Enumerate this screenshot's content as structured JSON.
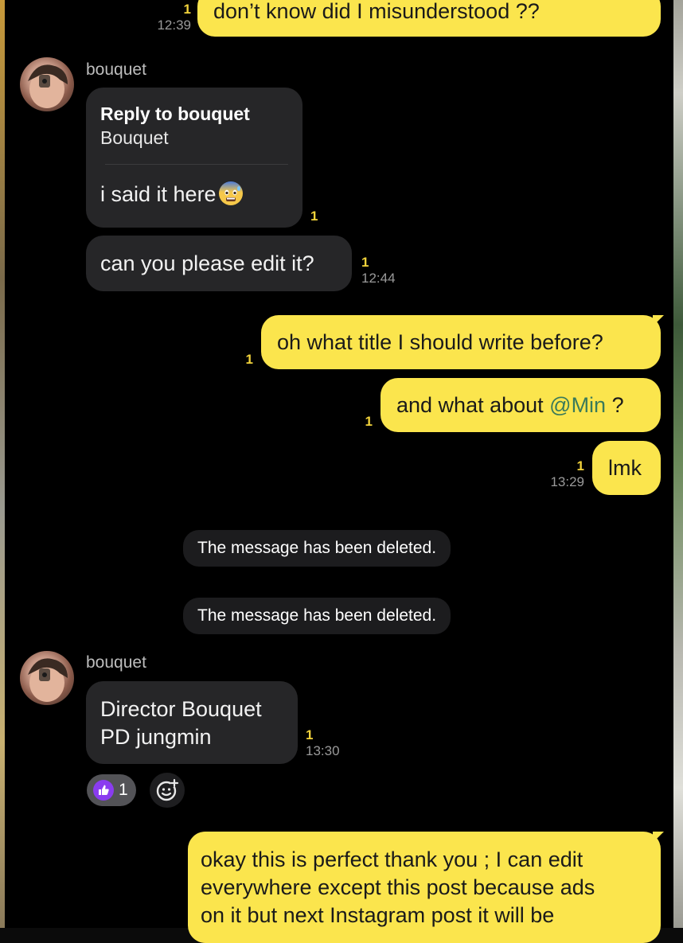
{
  "messages": {
    "m1": {
      "text": "don’t know did I misunderstood ??",
      "unread": "1",
      "time": "12:39"
    },
    "m2": {
      "sender": "bouquet",
      "reply_label": "Reply to bouquet",
      "reply_quote": "Bouquet",
      "text": "i said it here",
      "emoji": "anxious-face-emoji",
      "unread": "1"
    },
    "m3": {
      "text": "can you please edit it?",
      "unread": "1",
      "time": "12:44"
    },
    "m4": {
      "text": "oh what title I should write before?",
      "unread": "1"
    },
    "m5": {
      "text_before": "and what about ",
      "mention": "@Min",
      "text_after": " ?",
      "unread": "1"
    },
    "m6": {
      "text": "lmk",
      "unread": "1",
      "time": "13:29"
    },
    "deleted1": {
      "text": "The message has been deleted."
    },
    "deleted2": {
      "text": "The message has been deleted."
    },
    "m7": {
      "sender": "bouquet",
      "line1": "Director Bouquet",
      "line2": "PD jungmin",
      "unread": "1",
      "time": "13:30",
      "reaction": {
        "icon": "thumbs-up-icon",
        "count": "1"
      },
      "add_reaction_icon": "add-reaction-icon"
    },
    "m8": {
      "line1": "okay this is perfect thank you ; I can edit",
      "line2": "everywhere except this post because ads",
      "line3": "on it but next Instagram post it will be"
    }
  },
  "colors": {
    "outgoing_bubble": "#fbe54d",
    "incoming_bubble": "#262628",
    "unread_count": "#f2d33b",
    "reaction": "#8a3cf0",
    "mention": "#3a7a5a"
  }
}
